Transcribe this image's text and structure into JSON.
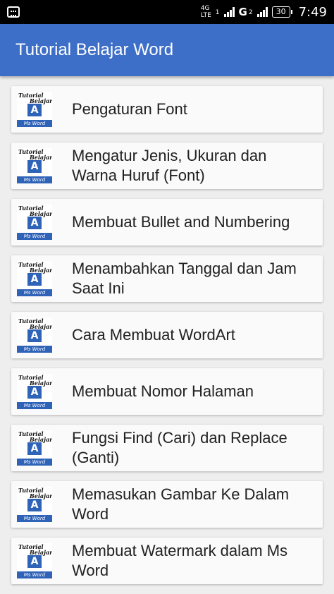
{
  "status_bar": {
    "network_type": "4G",
    "network_sub": "LTE",
    "sim1_label": "1",
    "sim2_letter": "G",
    "sim2_label": "2",
    "battery": "30",
    "time": "7:49",
    "notification_icon": "bbm-icon"
  },
  "app_bar": {
    "title": "Tutorial Belajar Word"
  },
  "thumb": {
    "line1": "Tutorial",
    "line2": "Belajar",
    "letter": "A",
    "footer": "Ms Word"
  },
  "items": [
    {
      "title": "Pengaturan Font"
    },
    {
      "title": "Mengatur Jenis, Ukuran dan Warna Huruf (Font)"
    },
    {
      "title": "Membuat Bullet and Numbering"
    },
    {
      "title": "Menambahkan Tanggal dan Jam Saat Ini"
    },
    {
      "title": "Cara Membuat WordArt"
    },
    {
      "title": "Membuat Nomor Halaman"
    },
    {
      "title": "Fungsi Find (Cari) dan Replace (Ganti)"
    },
    {
      "title": "Memasukan Gambar Ke Dalam Word"
    },
    {
      "title": "Membuat Watermark dalam Ms Word"
    }
  ],
  "colors": {
    "app_bar": "#3e6fc8",
    "thumb_blue": "#2f63b8",
    "background": "#eeeeee"
  }
}
